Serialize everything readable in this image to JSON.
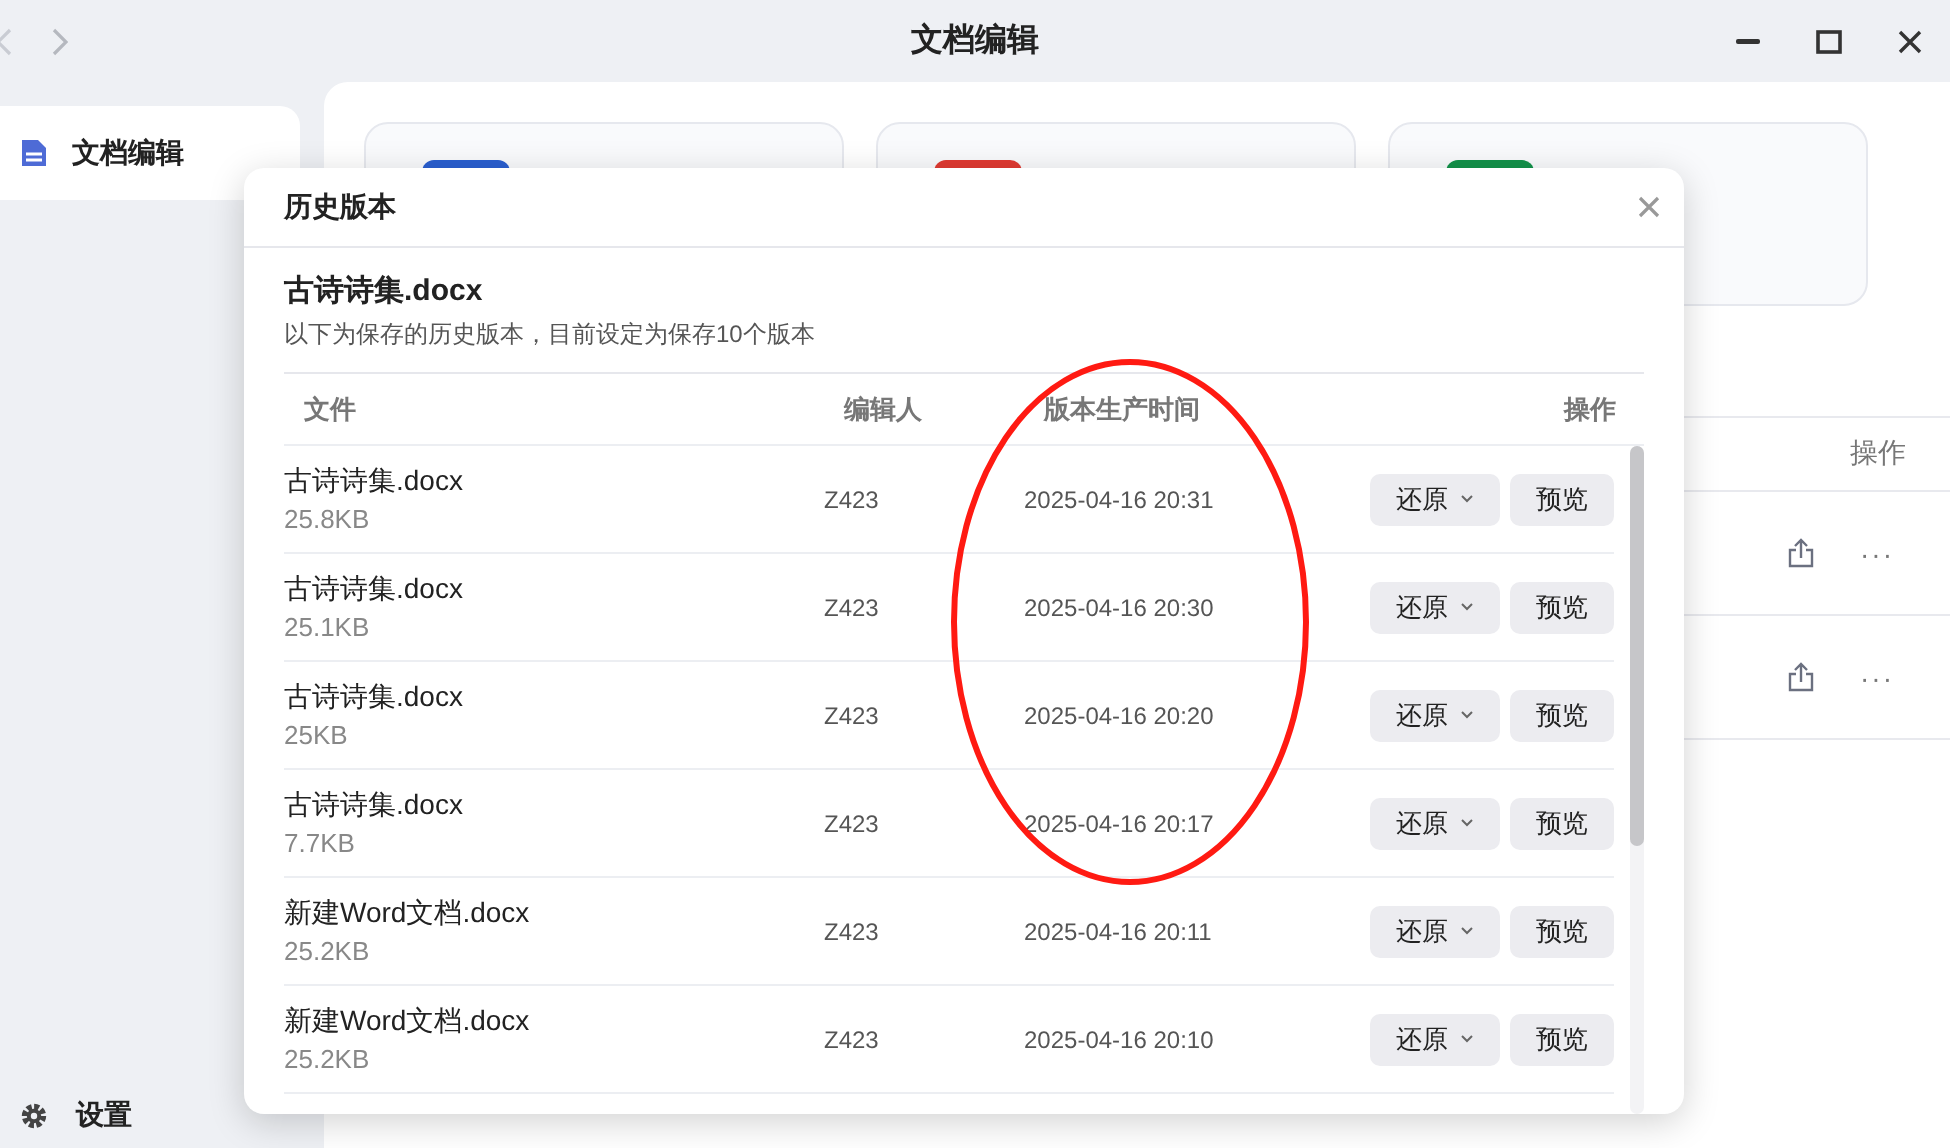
{
  "window": {
    "title": "文档编辑"
  },
  "sidebar": {
    "items": [
      {
        "label": "文档编辑",
        "selected": true
      }
    ],
    "settings": "设置"
  },
  "cards": [
    {
      "color": "#2a5fd0"
    },
    {
      "color": "#e03a32"
    },
    {
      "color": "#13924a"
    }
  ],
  "file_table": {
    "action_header": "操作",
    "rows": [
      {
        "actions": "···"
      },
      {
        "actions": "···"
      }
    ]
  },
  "dialog": {
    "title": "历史版本",
    "file_name": "古诗诗集.docx",
    "description": "以下为保存的历史版本，目前设定为保存10个版本",
    "columns": [
      "文件",
      "编辑人",
      "版本生产时间",
      "操作"
    ],
    "rows": [
      {
        "name": "古诗诗集.docx",
        "size": "25.8KB",
        "editor": "Z423",
        "time": "2025-04-16 20:31",
        "restore": "还原",
        "preview": "预览"
      },
      {
        "name": "古诗诗集.docx",
        "size": "25.1KB",
        "editor": "Z423",
        "time": "2025-04-16 20:30",
        "restore": "还原",
        "preview": "预览"
      },
      {
        "name": "古诗诗集.docx",
        "size": "25KB",
        "editor": "Z423",
        "time": "2025-04-16 20:20",
        "restore": "还原",
        "preview": "预览"
      },
      {
        "name": "古诗诗集.docx",
        "size": "7.7KB",
        "editor": "Z423",
        "time": "2025-04-16 20:17",
        "restore": "还原",
        "preview": "预览"
      },
      {
        "name": "新建Word文档.docx",
        "size": "25.2KB",
        "editor": "Z423",
        "time": "2025-04-16 20:11",
        "restore": "还原",
        "preview": "预览"
      },
      {
        "name": "新建Word文档.docx",
        "size": "25.2KB",
        "editor": "Z423",
        "time": "2025-04-16 20:10",
        "restore": "还原",
        "preview": "预览"
      }
    ]
  },
  "annotations": [
    {
      "kind": "ellipse",
      "color": "#ff1a12"
    }
  ]
}
